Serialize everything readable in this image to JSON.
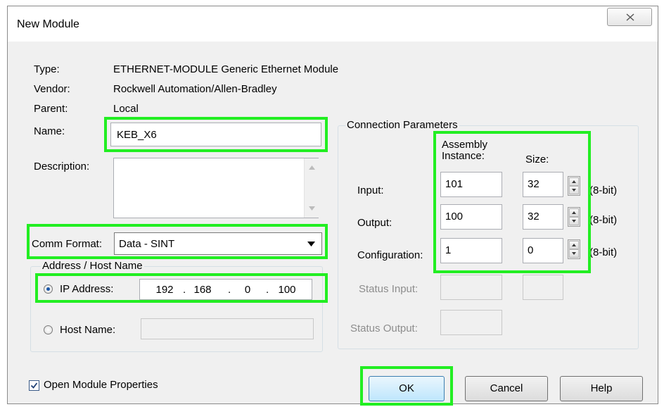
{
  "window": {
    "title": "New Module"
  },
  "info": {
    "type_label": "Type:",
    "type_value": "ETHERNET-MODULE Generic Ethernet Module",
    "vendor_label": "Vendor:",
    "vendor_value": "Rockwell Automation/Allen-Bradley",
    "parent_label": "Parent:",
    "parent_value": "Local",
    "name_label": "Name:",
    "name_value": "KEB_X6",
    "description_label": "Description:",
    "description_value": "",
    "comm_format_label": "Comm Format:",
    "comm_format_value": "Data - SINT"
  },
  "address": {
    "group_label": "Address / Host Name",
    "ip_label": "IP Address:",
    "ip": [
      "192",
      "168",
      "0",
      "100"
    ],
    "ip_dot": ".",
    "host_label": "Host Name:",
    "host_value": ""
  },
  "connection": {
    "group_label": "Connection Parameters",
    "col_instance": "Assembly\nInstance:",
    "col_size": "Size:",
    "rows": [
      {
        "label": "Input:",
        "instance": "101",
        "size": "32",
        "unit": "(8-bit)"
      },
      {
        "label": "Output:",
        "instance": "100",
        "size": "32",
        "unit": "(8-bit)"
      },
      {
        "label": "Configuration:",
        "instance": "1",
        "size": "0",
        "unit": "(8-bit)"
      }
    ],
    "status_input_label": "Status Input:",
    "status_output_label": "Status Output:"
  },
  "footer": {
    "open_props_label": "Open Module Properties",
    "open_props_checked": true,
    "ok_label": "OK",
    "cancel_label": "Cancel",
    "help_label": "Help"
  },
  "colors": {
    "highlight": "#22ee22",
    "dialog_bg": "#f0f0f0"
  }
}
